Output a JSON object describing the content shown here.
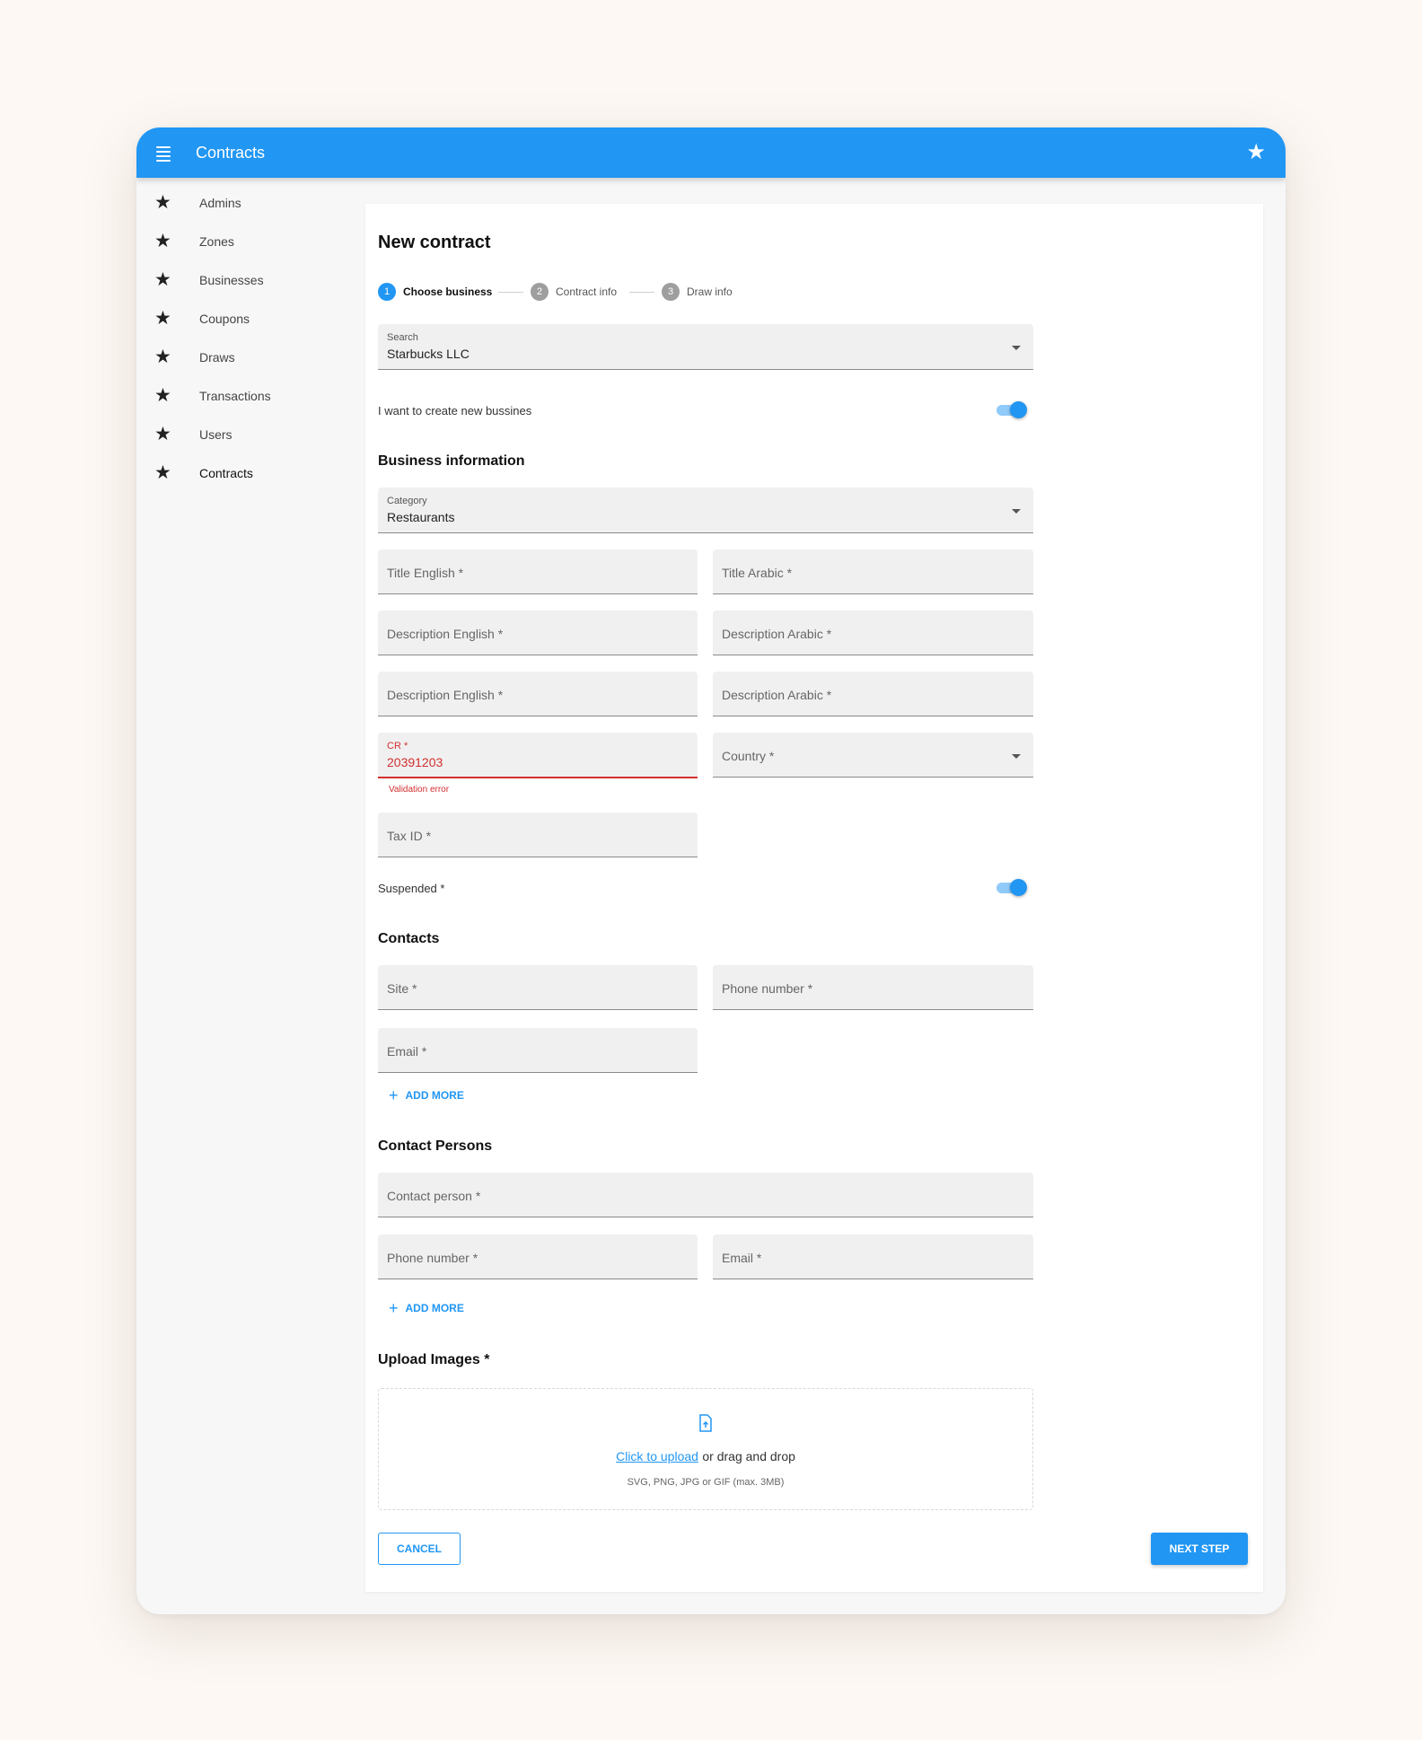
{
  "app": {
    "title": "Contracts"
  },
  "sidebar": {
    "items": [
      {
        "label": "Admins"
      },
      {
        "label": "Zones"
      },
      {
        "label": "Businesses"
      },
      {
        "label": "Coupons"
      },
      {
        "label": "Draws"
      },
      {
        "label": "Transactions"
      },
      {
        "label": "Users"
      },
      {
        "label": "Contracts",
        "active": true
      }
    ]
  },
  "page": {
    "title": "New contract"
  },
  "stepper": {
    "steps": [
      {
        "number": "1",
        "label": "Choose business",
        "active": true
      },
      {
        "number": "2",
        "label": "Contract info",
        "active": false
      },
      {
        "number": "3",
        "label": "Draw info",
        "active": false
      }
    ]
  },
  "search": {
    "label": "Search",
    "value": "Starbucks LLC"
  },
  "create_new": {
    "label": "I want to create new bussines",
    "on": true
  },
  "business": {
    "section_title": "Business information",
    "category": {
      "label": "Category",
      "value": "Restaurants"
    },
    "title_en": "Title English *",
    "title_ar": "Title Arabic *",
    "desc_en_1": "Description English *",
    "desc_ar_1": "Description Arabic *",
    "desc_en_2": "Description English *",
    "desc_ar_2": "Description Arabic *",
    "cr": {
      "label": "CR *",
      "value": "20391203",
      "error": "Validation error"
    },
    "country": "Country *",
    "tax_id": "Tax ID *",
    "suspended": {
      "label": "Suspended *",
      "on": true
    }
  },
  "contacts": {
    "section_title": "Contacts",
    "site": "Site *",
    "phone": "Phone number *",
    "email": "Email *",
    "add_more": "ADD MORE"
  },
  "contact_persons": {
    "section_title": "Contact Persons",
    "person": "Contact person *",
    "phone": "Phone number *",
    "email": "Email *",
    "add_more": "ADD MORE"
  },
  "upload": {
    "section_title": "Upload Images *",
    "link": "Click to upload",
    "rest": "or drag and drop",
    "hint": "SVG, PNG, JPG or GIF (max. 3MB)"
  },
  "actions": {
    "cancel": "CANCEL",
    "next": "NEXT STEP"
  },
  "colors": {
    "primary": "#2196f3",
    "error": "#d32f2f",
    "toggle_track": "#90caf9"
  }
}
